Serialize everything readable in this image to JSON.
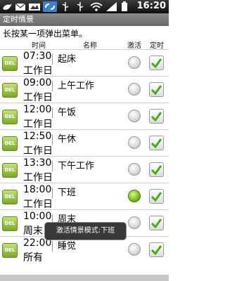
{
  "status_bar": {
    "time": "16:20",
    "icons": [
      "bird-icon",
      "email-icon",
      "notification-icon",
      "usb-icon",
      "link-icon",
      "wifi-icon",
      "signal-icon",
      "battery-icon"
    ]
  },
  "title_bar": {
    "title": "定时情景"
  },
  "hint": "长按某一项弹出菜单。",
  "columns": {
    "time": "时间",
    "name": "名称",
    "activate": "激活",
    "scheduled": "定时"
  },
  "rows": [
    {
      "time": "07:30",
      "name": "起床",
      "days": "工作日",
      "active": false,
      "scheduled": true
    },
    {
      "time": "09:00",
      "name": "上午工作",
      "days": "工作日",
      "active": false,
      "scheduled": true
    },
    {
      "time": "12:00",
      "name": "午饭",
      "days": "工作日",
      "active": false,
      "scheduled": true
    },
    {
      "time": "12:50",
      "name": "午休",
      "days": "工作日",
      "active": false,
      "scheduled": true
    },
    {
      "time": "13:30",
      "name": "下午工作",
      "days": "工作日",
      "active": false,
      "scheduled": true
    },
    {
      "time": "18:00",
      "name": "下班",
      "days": "工作日",
      "active": true,
      "scheduled": true
    },
    {
      "time": "10:00",
      "name": "周末",
      "days": "周末",
      "active": false,
      "scheduled": true
    },
    {
      "time": "22:00",
      "name": "睡觉",
      "days": "所有",
      "active": false,
      "scheduled": true
    }
  ],
  "delete_label": "DEL",
  "toast": "激活情景模式:下班",
  "colors": {
    "active_radio": "#7cc020",
    "check": "#4aa81e",
    "del_button": "#8fbf3a"
  }
}
